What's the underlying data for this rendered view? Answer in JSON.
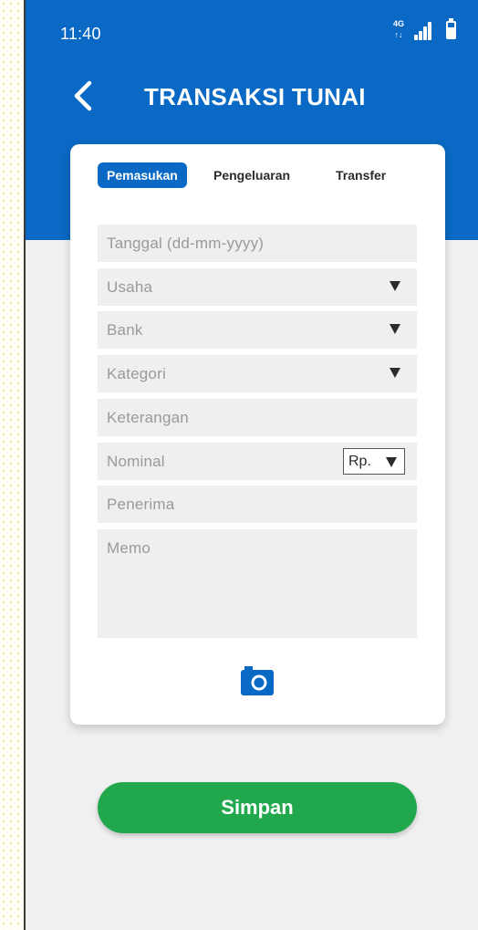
{
  "status_bar": {
    "time": "11:40",
    "network_label": "4G",
    "network_arrows": "↑↓",
    "signal_icon": "signal-bars-icon",
    "battery_icon": "battery-icon"
  },
  "header": {
    "back_icon": "chevron-left-icon",
    "title": "TRANSAKSI TUNAI"
  },
  "tabs": [
    {
      "label": "Pemasukan",
      "active": true
    },
    {
      "label": "Pengeluaran",
      "active": false
    },
    {
      "label": "Transfer",
      "active": false
    }
  ],
  "form": {
    "tanggal_placeholder": "Tanggal (dd-mm-yyyy)",
    "usaha_placeholder": "Usaha",
    "bank_placeholder": "Bank",
    "kategori_placeholder": "Kategori",
    "keterangan_placeholder": "Keterangan",
    "nominal_placeholder": "Nominal",
    "currency_value": "Rp.",
    "penerima_placeholder": "Penerima",
    "memo_placeholder": "Memo",
    "camera_icon": "camera-icon"
  },
  "actions": {
    "save_label": "Simpan"
  },
  "colors": {
    "primary": "#0a69c4",
    "save_button": "#21a84c",
    "field_bg": "#efefef",
    "placeholder_text": "#9a9a9a"
  }
}
